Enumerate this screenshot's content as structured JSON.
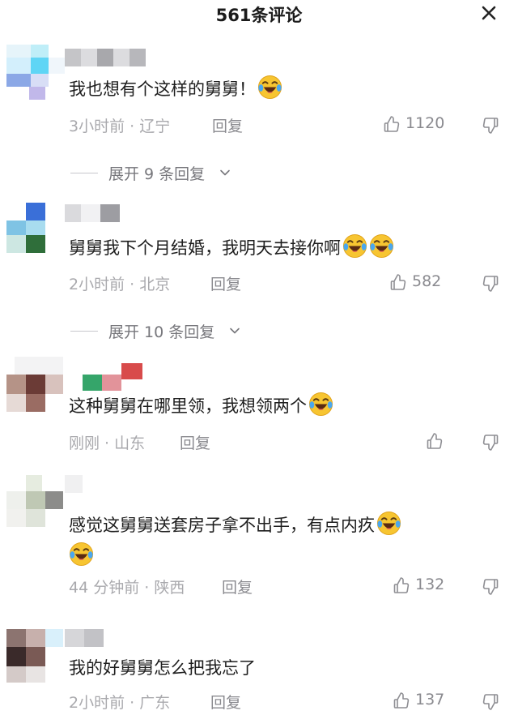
{
  "header": {
    "title": "561条评论"
  },
  "icons": {
    "close": "close-icon",
    "like": "thumb-up-icon",
    "dislike": "thumb-down-icon",
    "emoji": "laughing-crying-emoji-icon",
    "expand": "chevron-down-icon"
  },
  "colors": {
    "text": "#161823",
    "meta": "#a9a9ad",
    "action": "#8a8a8f"
  },
  "comments": [
    {
      "text": "我也想有个这样的舅舅！",
      "emoji_count": 1,
      "time": "3小时前",
      "location": "辽宁",
      "reply_label": "回复",
      "likes": "1120",
      "expand_label": "展开 9 条回复"
    },
    {
      "text": "舅舅我下个月结婚，我明天去接你啊",
      "emoji_count": 2,
      "time": "2小时前",
      "location": "北京",
      "reply_label": "回复",
      "likes": "582",
      "expand_label": "展开 10 条回复"
    },
    {
      "text": "这种舅舅在哪里领，我想领两个",
      "emoji_count": 1,
      "time": "刚刚",
      "location": "山东",
      "reply_label": "回复",
      "likes": ""
    },
    {
      "text": "感觉这舅舅送套房子拿不出手，有点内疚",
      "emoji_count": 2,
      "time": "44 分钟前",
      "location": "陕西",
      "reply_label": "回复",
      "likes": "132"
    },
    {
      "text": "我的好舅舅怎么把我忘了",
      "emoji_count": 0,
      "time": "2小时前",
      "location": "广东",
      "reply_label": "回复",
      "likes": "137"
    }
  ]
}
